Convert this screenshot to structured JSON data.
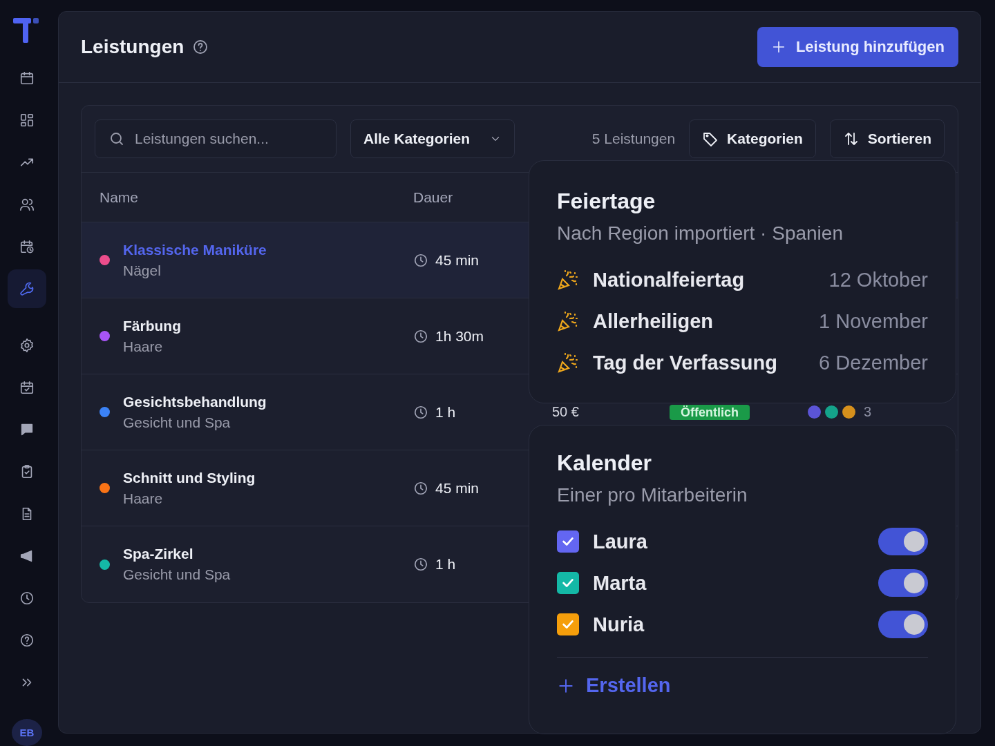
{
  "sidebar": {
    "items": [
      {
        "selected": false
      },
      {
        "selected": false
      },
      {
        "selected": false
      },
      {
        "selected": false
      },
      {
        "selected": false
      },
      {
        "selected": true
      },
      {
        "selected": false
      },
      {
        "selected": false
      },
      {
        "selected": false
      },
      {
        "selected": false
      },
      {
        "selected": false
      },
      {
        "selected": false
      },
      {
        "selected": false
      },
      {
        "selected": false
      },
      {
        "selected": false
      }
    ],
    "avatar": "EB"
  },
  "header": {
    "title": "Leistungen",
    "add_button": "Leistung hinzufügen"
  },
  "toolbar": {
    "search": {
      "placeholder": "Leistungen suchen..."
    },
    "category_filter": "Alle Kategorien",
    "count": "5 Leistungen",
    "categories_button": "Kategorien",
    "sort_button": "Sortieren"
  },
  "table": {
    "columns": [
      "Name",
      "Dauer"
    ],
    "rows": [
      {
        "name": "Klassische Maniküre",
        "category": "Nägel",
        "color": "#ec4d8c",
        "duration": "45 min",
        "selected": true
      },
      {
        "name": "Färbung",
        "category": "Haare",
        "color": "#a855f7",
        "duration": "1h 30m",
        "selected": false
      },
      {
        "name": "Gesichtsbehandlung",
        "category": "Gesicht und Spa",
        "color": "#3b82f6",
        "duration": "1 h",
        "selected": false,
        "price": "50 €",
        "status": "Öffentlich",
        "staff": [
          {
            "color": "#5b54d6"
          },
          {
            "color": "#14a38b"
          },
          {
            "color": "#d6901c"
          }
        ],
        "staff_count": "3"
      },
      {
        "name": "Schnitt und Styling",
        "category": "Haare",
        "color": "#f97316",
        "duration": "45 min",
        "selected": false
      },
      {
        "name": "Spa-Zirkel",
        "category": "Gesicht und Spa",
        "color": "#14b8a6",
        "duration": "1 h",
        "selected": false
      }
    ]
  },
  "holidays": {
    "title": "Feiertage",
    "subtitle": "Nach Region importiert · Spanien",
    "items": [
      {
        "name": "Nationalfeiertag",
        "date": "12 Oktober"
      },
      {
        "name": "Allerheiligen",
        "date": "1 November"
      },
      {
        "name": "Tag der Verfassung",
        "date": "6 Dezember"
      }
    ]
  },
  "calendars": {
    "title": "Kalender",
    "subtitle": "Einer pro Mitarbeiterin",
    "items": [
      {
        "name": "Laura",
        "color": "#6366f1",
        "checked": true,
        "on": true
      },
      {
        "name": "Marta",
        "color": "#14b8a6",
        "checked": true,
        "on": true
      },
      {
        "name": "Nuria",
        "color": "#f59e0b",
        "checked": true,
        "on": true
      }
    ],
    "create_button": "Erstellen"
  }
}
